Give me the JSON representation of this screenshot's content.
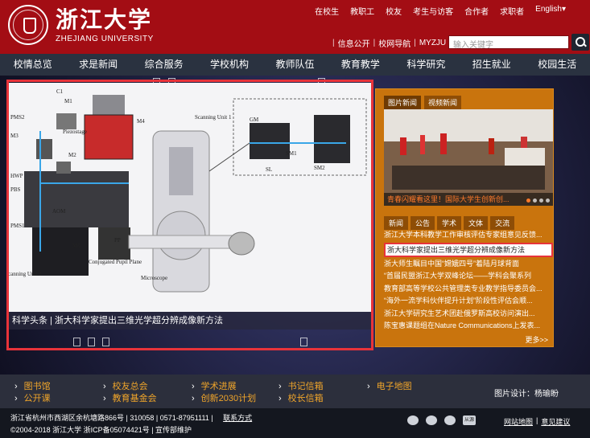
{
  "header": {
    "logo_cn": "浙江大学",
    "logo_en": "ZHEJIANG UNIVERSITY",
    "top_links": [
      "在校生",
      "教职工",
      "校友",
      "考生与访客",
      "合作者",
      "求职者",
      "English▾"
    ],
    "sub_links": [
      "信息公开",
      "校网导航",
      "MYZJU"
    ],
    "search_placeholder": "输入关键字"
  },
  "nav": [
    "校情总览",
    "求是新闻",
    "综合服务",
    "学校机构",
    "教师队伍",
    "教育教学",
    "科学研究",
    "招生就业",
    "校园生活"
  ],
  "banner": {
    "caption": "科学头条 | 浙大科学家提出三维光学超分辨成像新方法",
    "figure_labels": [
      "C1",
      "M1",
      "PMS2",
      "Piezostage",
      "M3",
      "M2",
      "M4",
      "HWP",
      "PBS",
      "AOM",
      "PMS1",
      "M5",
      "Scanning Unit 1",
      "GM",
      "SM1",
      "SM2",
      "SL",
      "Conjugated Pupil Plane",
      "Microscope",
      "canning Unit 2",
      "PP"
    ]
  },
  "panel": {
    "tabs": [
      "图片新闻",
      "视频新闻"
    ],
    "photo_caption": "青春闪耀看这里！国际大学生创新创...",
    "news_tabs": [
      "新闻",
      "公告",
      "学术",
      "文体",
      "交流"
    ],
    "news": [
      "浙江大学本科教学工作审核评估专家组意见反馈...",
      "浙大科学家提出三维光学超分辨成像新方法",
      "浙大师生瞩目中国“嫦娥四号”着陆月球背面",
      "“首届民盟浙江大学双峰论坛——学科会聚系列",
      "教育部高等学校公共管理类专业教学指导委员会...",
      "“海外一流学科伙伴提升计划”阶段性评估会顺...",
      "浙江大学研究生艺术团赴俄罗斯高校访问演出...",
      "陈宝惠课题组在Nature Communications上发表..."
    ],
    "more": "更多>>"
  },
  "linkbar": {
    "links": [
      "图书馆",
      "公开课",
      "校友总会",
      "教育基金会",
      "学术进展",
      "创新2030计划",
      "书记信箱",
      "校长信箱",
      "电子地图"
    ],
    "credit": "图片设计：杨瑜盼"
  },
  "footer": {
    "line1": "浙江省杭州市西湖区余杭塘路866号 | 310058 | 0571-87951111 |",
    "contact": "联系方式",
    "line2": "©2004-2018 浙江大学 浙ICP备05074421号 | 宣传部维护",
    "social_tag": "从源",
    "links": [
      "网站地图",
      "|",
      "意见建议"
    ]
  },
  "colors": {
    "header_red": "#a30d14",
    "nav_dark": "#2a3240",
    "panel_orange": "#c9740d",
    "link_gold": "#f0a52a",
    "highlight_red": "#e8333a"
  }
}
